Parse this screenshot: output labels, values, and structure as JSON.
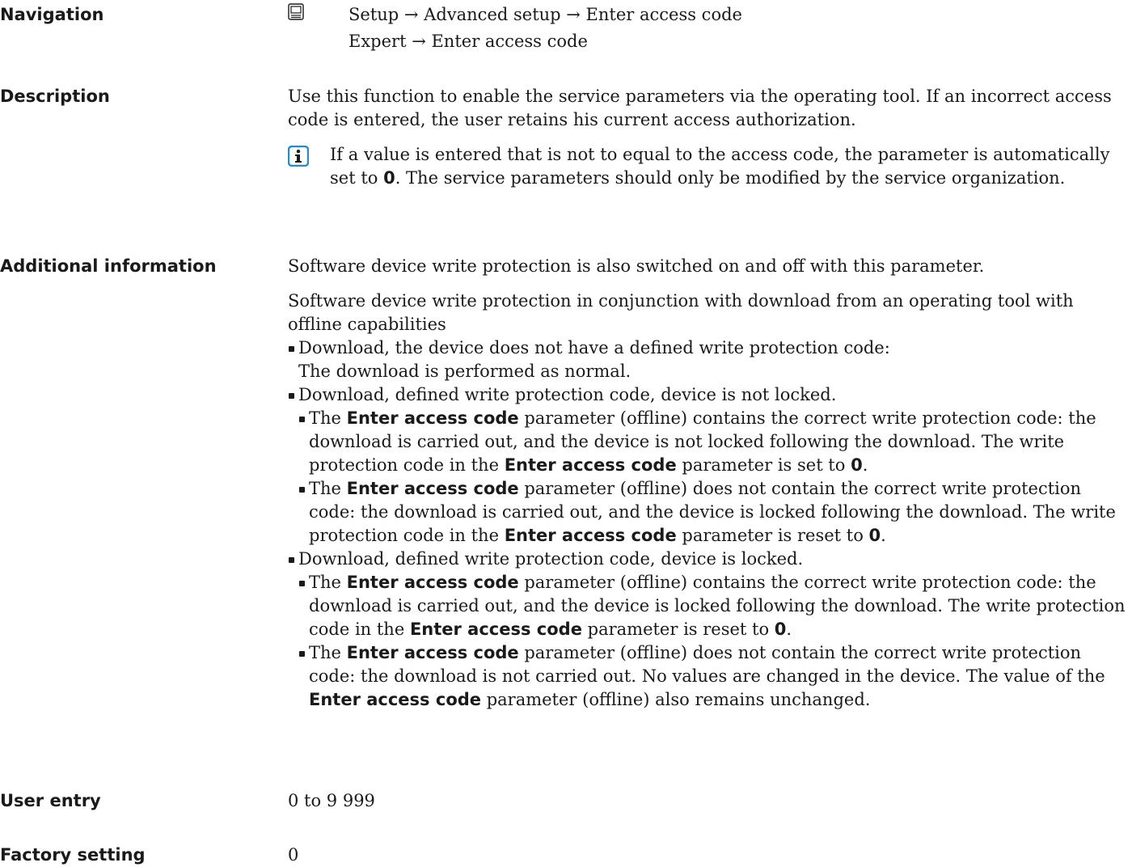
{
  "navigation": {
    "label": "Navigation",
    "path1": "Setup → Advanced setup → Enter access code",
    "path2": "Expert → Enter access code"
  },
  "description": {
    "label": "Description",
    "text": "Use this function to enable the service parameters via the operating tool. If an incorrect access code is entered, the user retains his current access authorization.",
    "note_a": "If a value is entered that is not to equal to the access code, the parameter is automatically set to ",
    "note_zero": "0",
    "note_b": ". The service parameters should only be modified by the service organization."
  },
  "additional": {
    "label": "Additional information",
    "p1": "Software device write protection is also switched on and off with this parameter.",
    "p2": "Software device write protection in conjunction with download from an operating tool with offline capabilities",
    "b1_l1": "Download, the device does not have a defined write protection code:",
    "b1_l2": "The download is performed as normal.",
    "b2": "Download, defined write protection code, device is not locked.",
    "b3": "Download, defined write protection code, device is locked.",
    "param": "Enter access code",
    "zero": "0",
    "the": "The ",
    "s21_a": " parameter (offline) contains the correct write protection code: the download is carried out, and the device is not locked following the download. The write protection code in the ",
    "s21_b": " parameter is set to ",
    "s22_a": " parameter (offline) does not contain the correct write protection code: the download is carried out, and the device is locked following the download. The write protection code in the ",
    "s22_b": " parameter is reset to ",
    "s31_a": " parameter (offline) contains the correct write protection code: the download is carried out, and the device is locked following the download. The write protection code in the ",
    "s31_b": " parameter is reset to ",
    "s32_a": " parameter (offline) does not contain the correct write protection code: the download is not carried out. No values are changed in the device. The value of the ",
    "s32_b": " parameter (offline) also remains unchanged.",
    "period": "."
  },
  "user_entry": {
    "label": "User entry",
    "value": "0 to 9 999"
  },
  "factory": {
    "label": "Factory setting",
    "value": "0"
  },
  "icons": {
    "navigation": "display-module-icon",
    "note": "info-icon"
  }
}
